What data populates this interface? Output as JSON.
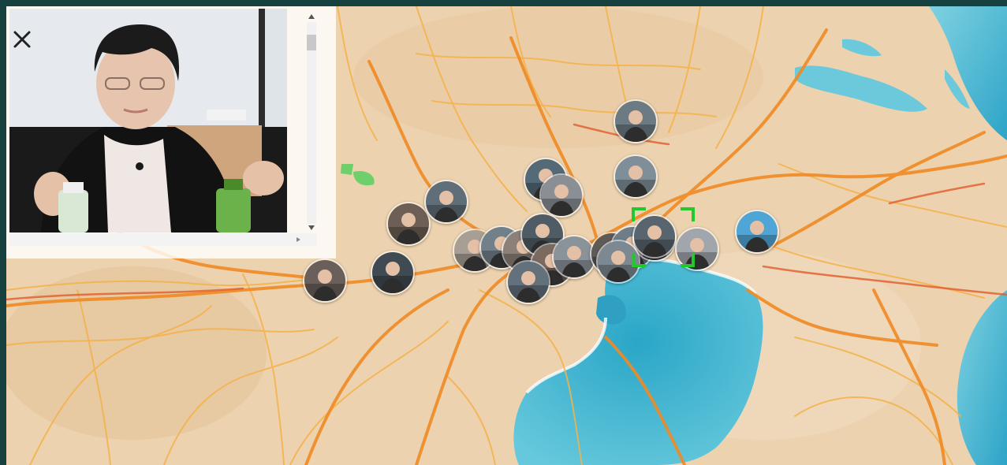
{
  "map": {
    "style": "watercolor",
    "colors": {
      "land": "#ecd2ae",
      "water": "#3bb3cf",
      "road_major": "#f08a24",
      "road_minor": "#f6b14a",
      "frame": "#16413f",
      "selection": "#21c92b"
    },
    "markers": [
      {
        "id": "m1",
        "icon": "person-photo-icon",
        "tone": "#6b7a83"
      },
      {
        "id": "m2",
        "icon": "person-photo-icon",
        "tone": "#7f8f9a"
      },
      {
        "id": "m3",
        "icon": "person-photo-icon",
        "tone": "#556a77"
      },
      {
        "id": "m4",
        "icon": "person-photo-icon",
        "tone": "#8a8f96"
      },
      {
        "id": "m5",
        "icon": "person-photo-icon",
        "tone": "#6d5f55"
      },
      {
        "id": "m6",
        "icon": "person-photo-icon",
        "tone": "#5f6e78"
      },
      {
        "id": "m7",
        "icon": "person-photo-icon",
        "tone": "#a89f94"
      },
      {
        "id": "m8",
        "icon": "person-photo-icon",
        "tone": "#72808a"
      },
      {
        "id": "m9",
        "icon": "person-photo-icon",
        "tone": "#8c8078"
      },
      {
        "id": "m10",
        "icon": "person-photo-icon",
        "tone": "#4f5c66"
      },
      {
        "id": "m11",
        "icon": "person-photo-icon",
        "tone": "#7a6a60"
      },
      {
        "id": "m12",
        "icon": "person-photo-icon",
        "tone": "#62717c"
      },
      {
        "id": "m13",
        "icon": "person-photo-icon",
        "tone": "#8b939a"
      },
      {
        "id": "m14",
        "icon": "person-photo-icon",
        "tone": "#5d5a58"
      },
      {
        "id": "m15",
        "icon": "person-photo-icon",
        "tone": "#6e7d88"
      },
      {
        "id": "m16",
        "icon": "person-photo-icon",
        "tone": "#9a948c"
      },
      {
        "id": "m17",
        "icon": "person-photo-icon",
        "tone": "#58656e"
      },
      {
        "id": "m18",
        "icon": "person-photo-icon",
        "tone": "#7c8892"
      },
      {
        "id": "m19",
        "icon": "person-photo-icon",
        "tone": "#a0a6ab"
      },
      {
        "id": "m20",
        "icon": "person-photo-icon",
        "tone": "#4fa6d6"
      },
      {
        "id": "m21",
        "icon": "person-photo-icon",
        "tone": "#3f4a52"
      },
      {
        "id": "m22",
        "icon": "person-photo-icon",
        "tone": "#6a5f5a"
      }
    ],
    "selected_marker": "m17"
  },
  "popup": {
    "photo_icon": "woman-speaking-photo",
    "close_icon": "close-icon",
    "scroll_up_icon": "triangle-up-icon",
    "scroll_down_icon": "triangle-down-icon",
    "scroll_right_icon": "triangle-right-icon"
  }
}
